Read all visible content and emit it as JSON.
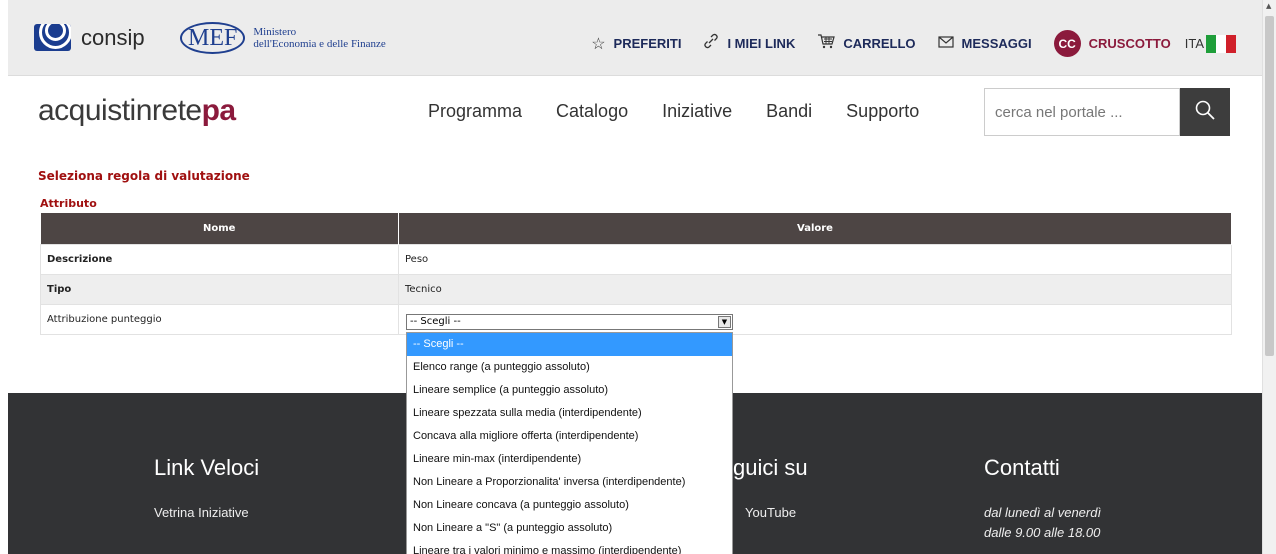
{
  "topbar": {
    "consip_label": "consip",
    "mef_mark": "MEF",
    "mef_line1": "Ministero",
    "mef_line2": "dell'Economia e delle Finanze",
    "links": [
      {
        "label": "PREFERITI",
        "icon": "star-icon"
      },
      {
        "label": "I MIEI LINK",
        "icon": "link-icon"
      },
      {
        "label": "CARRELLO",
        "icon": "cart-icon"
      },
      {
        "label": "MESSAGGI",
        "icon": "envelope-icon"
      }
    ],
    "avatar_initials": "CC",
    "cruscotto_label": "CRUSCOTTO",
    "language": "ITA"
  },
  "header": {
    "brand_part1": "acquistin",
    "brand_part2": "rete",
    "brand_part3": "pa",
    "nav": [
      "Programma",
      "Catalogo",
      "Iniziative",
      "Bandi",
      "Supporto"
    ],
    "search_placeholder": "cerca nel portale ..."
  },
  "content": {
    "section_title": "Seleziona regola di valutazione",
    "subsection_title": "Attributo",
    "table_headers": {
      "name": "Nome",
      "value": "Valore"
    },
    "rows": [
      {
        "name": "Descrizione",
        "value": "Peso"
      },
      {
        "name": "Tipo",
        "value": "Tecnico"
      },
      {
        "name": "Attribuzione punteggio",
        "value": ""
      }
    ],
    "select_value": "-- Scegli --",
    "options": [
      "-- Scegli --",
      "Elenco range (a punteggio assoluto)",
      "Lineare semplice (a punteggio assoluto)",
      "Lineare spezzata sulla media (interdipendente)",
      "Concava alla migliore offerta (interdipendente)",
      "Lineare min-max (interdipendente)",
      "Non Lineare a Proporzionalita' inversa (interdipendente)",
      "Non Lineare concava (a punteggio assoluto)",
      "Non Lineare a \"S\" (a punteggio assoluto)",
      "Lineare tra i valori minimo e massimo (interdipendente)"
    ]
  },
  "footer": {
    "col1_title": "Link Veloci",
    "col1_link": "Vetrina Iniziative",
    "col2_title": "guici su",
    "col2_link": "YouTube",
    "col3_title": "Contatti",
    "col3_line1": "dal lunedì al venerdì",
    "col3_line2": "dalle 9.00 alle 18.00"
  },
  "colors": {
    "brand_accent": "#8b1a3c",
    "table_header": "#4d4544",
    "footer_bg": "#323335",
    "dropdown_selected": "#3399ff",
    "section_title": "#a01010"
  }
}
